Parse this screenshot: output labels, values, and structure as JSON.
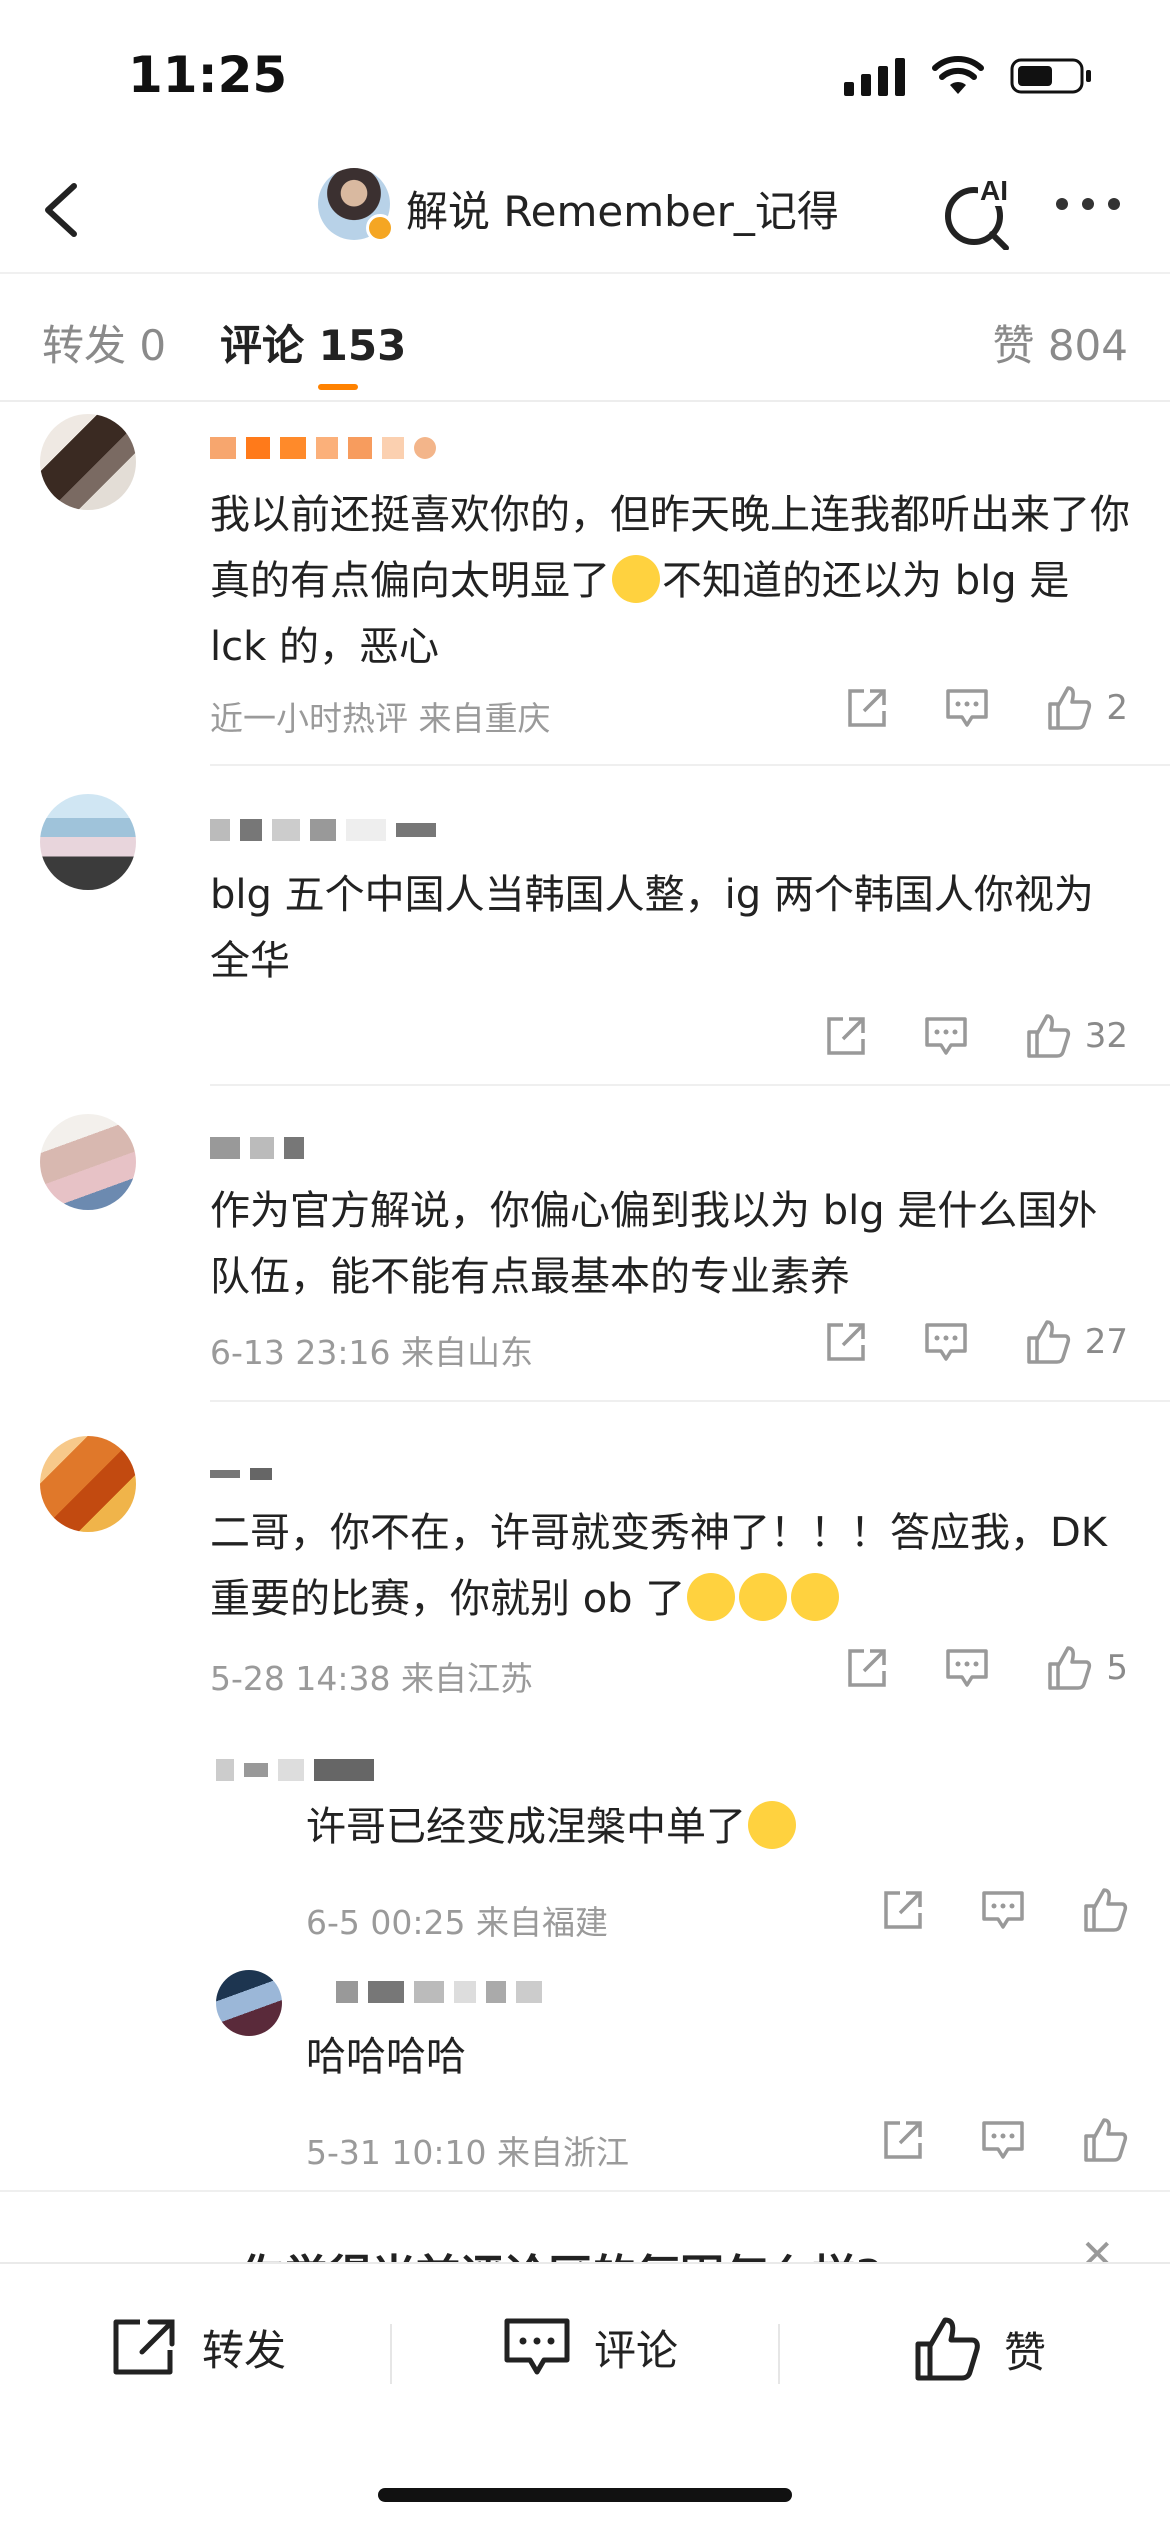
{
  "status_bar": {
    "time": "11:25"
  },
  "nav": {
    "title": "解说 Remember_记得",
    "ai_label": "AI"
  },
  "tabs": {
    "repost": "转发 0",
    "comments": "评论 153",
    "likes": "赞 804"
  },
  "comments": [
    {
      "text": "我以前还挺喜欢你的，但昨天晚上连我都听出来了你真的有点偏向太明显了",
      "text_tail": "不知道的还以为 blg 是 lck 的，恶心",
      "meta": "近一小时热评  来自重庆",
      "likes": "2"
    },
    {
      "text": "blg 五个中国人当韩国人整，ig 两个韩国人你视为全华",
      "meta": "",
      "likes": "32"
    },
    {
      "text": "作为官方解说，你偏心偏到我以为 blg 是什么国外队伍，能不能有点最基本的专业素养",
      "meta": "6-13 23:16  来自山东",
      "likes": "27"
    },
    {
      "text": "二哥，你不在，许哥就变秀神了！！！答应我，DK 重要的比赛，你就别 ob 了",
      "meta": "5-28 14:38  来自江苏",
      "likes": "5"
    }
  ],
  "replies": [
    {
      "text": "许哥已经变成涅槃中单了",
      "meta": "6-5 00:25  来自福建"
    },
    {
      "text": "哈哈哈哈",
      "meta": "5-31 10:10  来自浙江"
    }
  ],
  "survey": {
    "text": "你觉得当前评论区的氛围怎么样?"
  },
  "bottom_bar": {
    "repost": "转发",
    "comment": "评论",
    "like": "赞"
  }
}
